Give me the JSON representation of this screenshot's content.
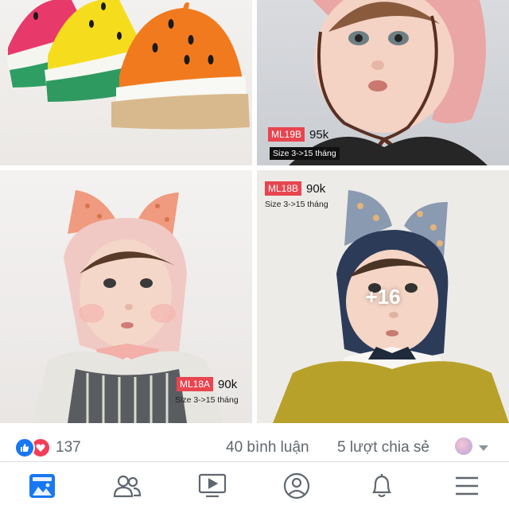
{
  "posts": [
    {
      "code": "ML19B",
      "price": "95k",
      "size": "Size 3->15 tháng"
    },
    {
      "code": "ML18B",
      "price": "90k",
      "size": "Size 3->15 tháng"
    },
    {
      "code": "ML18A",
      "price": "90k",
      "size": "Size 3->15 tháng"
    }
  ],
  "more_photos": "+16",
  "reactions": {
    "count": "137",
    "comments": "40 bình luận",
    "shares": "5 lượt chia sẻ"
  },
  "nav": [
    "news-feed-icon",
    "friends-icon",
    "watch-icon",
    "profile-icon",
    "notifications-icon",
    "menu-icon"
  ],
  "colors": {
    "facebook_blue": "#1877f2",
    "love_red": "#f33e58",
    "tag_red": "#e8454f",
    "icon_gray": "#606770"
  }
}
